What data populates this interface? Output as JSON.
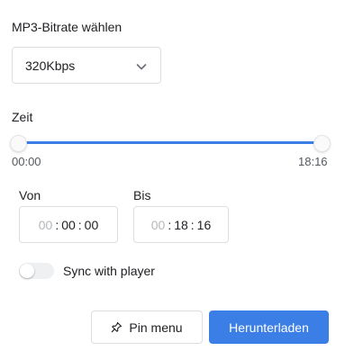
{
  "bitrate": {
    "label": "MP3-Bitrate wählen",
    "selected": "320Kbps",
    "chevron_icon": "chevron-down-icon"
  },
  "time_range": {
    "label": "Zeit",
    "start_label": "00:00",
    "end_label": "18:16",
    "range_start_fraction": 0,
    "range_end_fraction": 1,
    "accent_color": "#3b7ee6"
  },
  "from": {
    "label": "Von",
    "hours": "00",
    "minutes": "00",
    "seconds": "00"
  },
  "to": {
    "label": "Bis",
    "hours": "00",
    "minutes": "18",
    "seconds": "16"
  },
  "separator": ":",
  "sync": {
    "label": "Sync with player",
    "enabled": false
  },
  "actions": {
    "pin_label": "Pin menu",
    "pin_icon": "pin-icon",
    "download_label": "Herunterladen",
    "download_color": "#3b7ee6"
  }
}
